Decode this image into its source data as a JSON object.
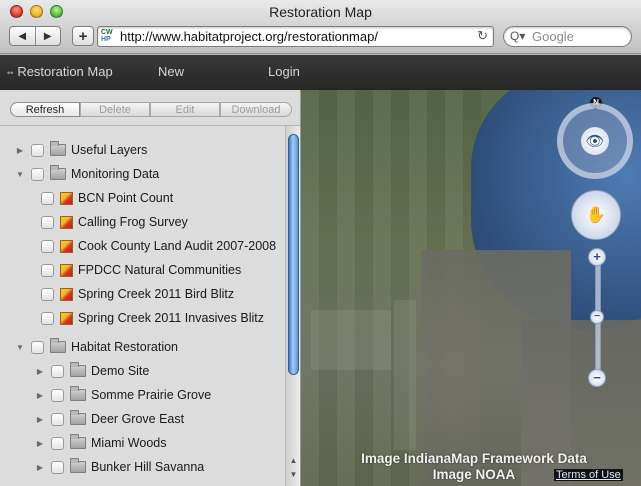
{
  "window": {
    "title": "Restoration Map",
    "back_glyph": "◀",
    "forward_glyph": "▶",
    "add_glyph": "+",
    "url": "http://www.habitatproject.org/restorationmap/",
    "favicon_top": "CW",
    "favicon_bottom": "HP",
    "reload_glyph": "↻",
    "search_placeholder": "Google",
    "search_icon_glyph": "Q▾"
  },
  "app_toolbar": {
    "brand": "Restoration Map",
    "new_label": "New",
    "login_label": "Login"
  },
  "actions": {
    "refresh": "Refresh",
    "delete": "Delete",
    "edit": "Edit",
    "download": "Download"
  },
  "tree": [
    {
      "label": "Useful Layers",
      "type": "folder",
      "level": 0,
      "expanded": false
    },
    {
      "label": "Monitoring Data",
      "type": "folder",
      "level": 0,
      "expanded": true
    },
    {
      "label": "BCN Point Count",
      "type": "layer",
      "level": 1
    },
    {
      "label": "Calling Frog Survey",
      "type": "layer",
      "level": 1
    },
    {
      "label": "Cook County Land Audit 2007-2008",
      "type": "layer",
      "level": 1
    },
    {
      "label": "FPDCC Natural Communities",
      "type": "layer",
      "level": 1
    },
    {
      "label": "Spring Creek 2011 Bird Blitz",
      "type": "layer",
      "level": 1
    },
    {
      "label": "Spring Creek 2011 Invasives Blitz",
      "type": "layer",
      "level": 1
    },
    {
      "label": "Habitat Restoration",
      "type": "folder",
      "level": 0,
      "expanded": true
    },
    {
      "label": "Demo Site",
      "type": "folder",
      "level": 1,
      "expanded": false
    },
    {
      "label": "Somme Prairie Grove",
      "type": "folder",
      "level": 1,
      "expanded": false
    },
    {
      "label": "Deer Grove East",
      "type": "folder",
      "level": 1,
      "expanded": false
    },
    {
      "label": "Miami Woods",
      "type": "folder",
      "level": 1,
      "expanded": false
    },
    {
      "label": "Bunker Hill Savanna",
      "type": "folder",
      "level": 1,
      "expanded": false
    }
  ],
  "scrollbar": {
    "up_glyph": "▲",
    "down_glyph": "▼"
  },
  "map": {
    "attribution_line1": "Image IndianaMap Framework Data",
    "attribution_line2": "Image NOAA",
    "terms_label": "Terms of Use",
    "north_label": "N",
    "look_glyph": "👁",
    "pan_glyph": "✋",
    "zoom_in_glyph": "+",
    "zoom_out_glyph": "−",
    "zoom_handle_glyph": "−",
    "arrow_up": "⌃",
    "arrow_down": "⌄",
    "arrow_left": "‹",
    "arrow_right": "›"
  }
}
